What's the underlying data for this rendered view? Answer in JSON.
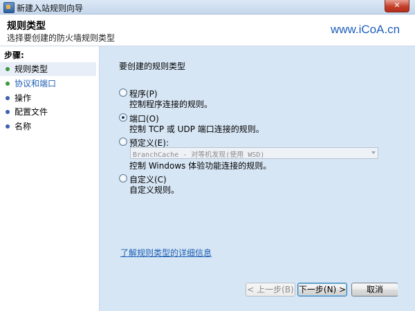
{
  "window": {
    "title": "新建入站规则向导",
    "close_glyph": "✕"
  },
  "header": {
    "title": "规则类型",
    "subtitle": "选择要创建的防火墙规则类型",
    "watermark": "www.iCoA.cn"
  },
  "sidebar": {
    "heading": "步骤:",
    "steps": [
      {
        "label": "规则类型",
        "state": "current",
        "dot_color": "#3a9a3a"
      },
      {
        "label": "协议和端口",
        "state": "link",
        "dot_color": "#3a9a3a"
      },
      {
        "label": "操作",
        "state": "normal",
        "dot_color": "#3a5fb0"
      },
      {
        "label": "配置文件",
        "state": "normal",
        "dot_color": "#3a5fb0"
      },
      {
        "label": "名称",
        "state": "normal",
        "dot_color": "#3a5fb0"
      }
    ]
  },
  "main": {
    "prompt": "要创建的规则类型",
    "options": [
      {
        "label": "程序(P)",
        "desc": "控制程序连接的规则。",
        "checked": false
      },
      {
        "label": "端口(O)",
        "desc": "控制 TCP 或 UDP 端口连接的规则。",
        "checked": true
      },
      {
        "label": "预定义(E):",
        "desc": "控制 Windows 体验功能连接的规则。",
        "checked": false
      },
      {
        "label": "自定义(C)",
        "desc": "自定义规则。",
        "checked": false
      }
    ],
    "predefined_select_value": "BranchCache - 对等机发现(使用 WSD)",
    "more_info_link": "了解规则类型的详细信息"
  },
  "buttons": {
    "back": "< 上一步(B)",
    "next": "下一步(N) >",
    "cancel": "取消"
  },
  "colors": {
    "accent_link": "#1e5fb4",
    "panel_bg": "#d7e6f5",
    "watermark": "#1d5fbd"
  }
}
